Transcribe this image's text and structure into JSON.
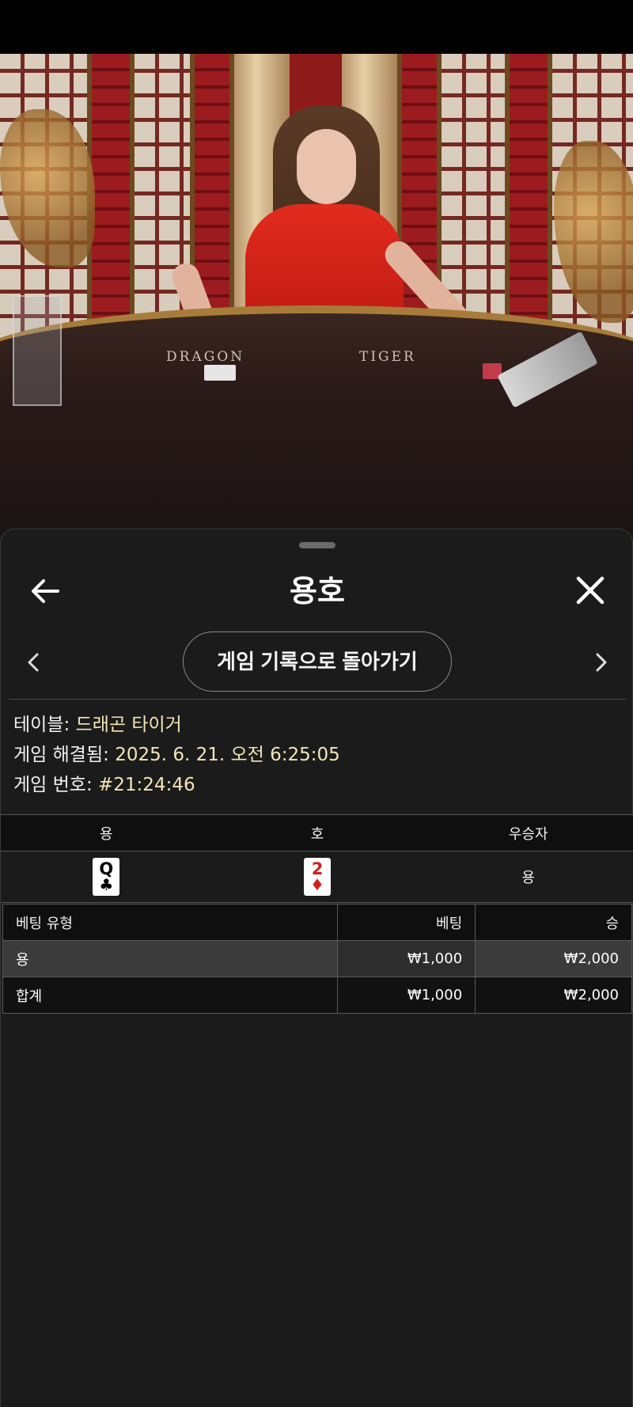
{
  "video": {
    "table_labels": [
      "DRAGON",
      "TIGER"
    ]
  },
  "header": {
    "title": "용호",
    "back_icon": "arrow-left-icon",
    "close_icon": "close-icon"
  },
  "nav": {
    "history_button": "게임 기록으로 돌아가기",
    "prev_icon": "chevron-left-icon",
    "next_icon": "chevron-right-icon"
  },
  "info": {
    "table_label": "테이블:",
    "table_value": "드래곤 타이거",
    "resolved_label": "게임 해결됨:",
    "resolved_value": "2025. 6. 21. 오전 6:25:05",
    "round_label": "게임 번호:",
    "round_value": "#21:24:46"
  },
  "results": {
    "headers": [
      "용",
      "호",
      "우승자"
    ],
    "dragon_card": {
      "rank": "Q",
      "suit": "♣",
      "color": "#000000"
    },
    "tiger_card": {
      "rank": "2",
      "suit": "♦",
      "color": "#d0201a"
    },
    "winner": "용"
  },
  "bets": {
    "headers": [
      "베팅 유형",
      "베팅",
      "승"
    ],
    "rows": [
      {
        "type": "용",
        "bet": "₩1,000",
        "win": "₩2,000"
      }
    ],
    "total": {
      "type": "합계",
      "bet": "₩1,000",
      "win": "₩2,000"
    }
  },
  "colors": {
    "sheet_bg": "#1b1b1b",
    "info_value": "#f4e6b6",
    "highlight_row": "#3b3b3b"
  }
}
